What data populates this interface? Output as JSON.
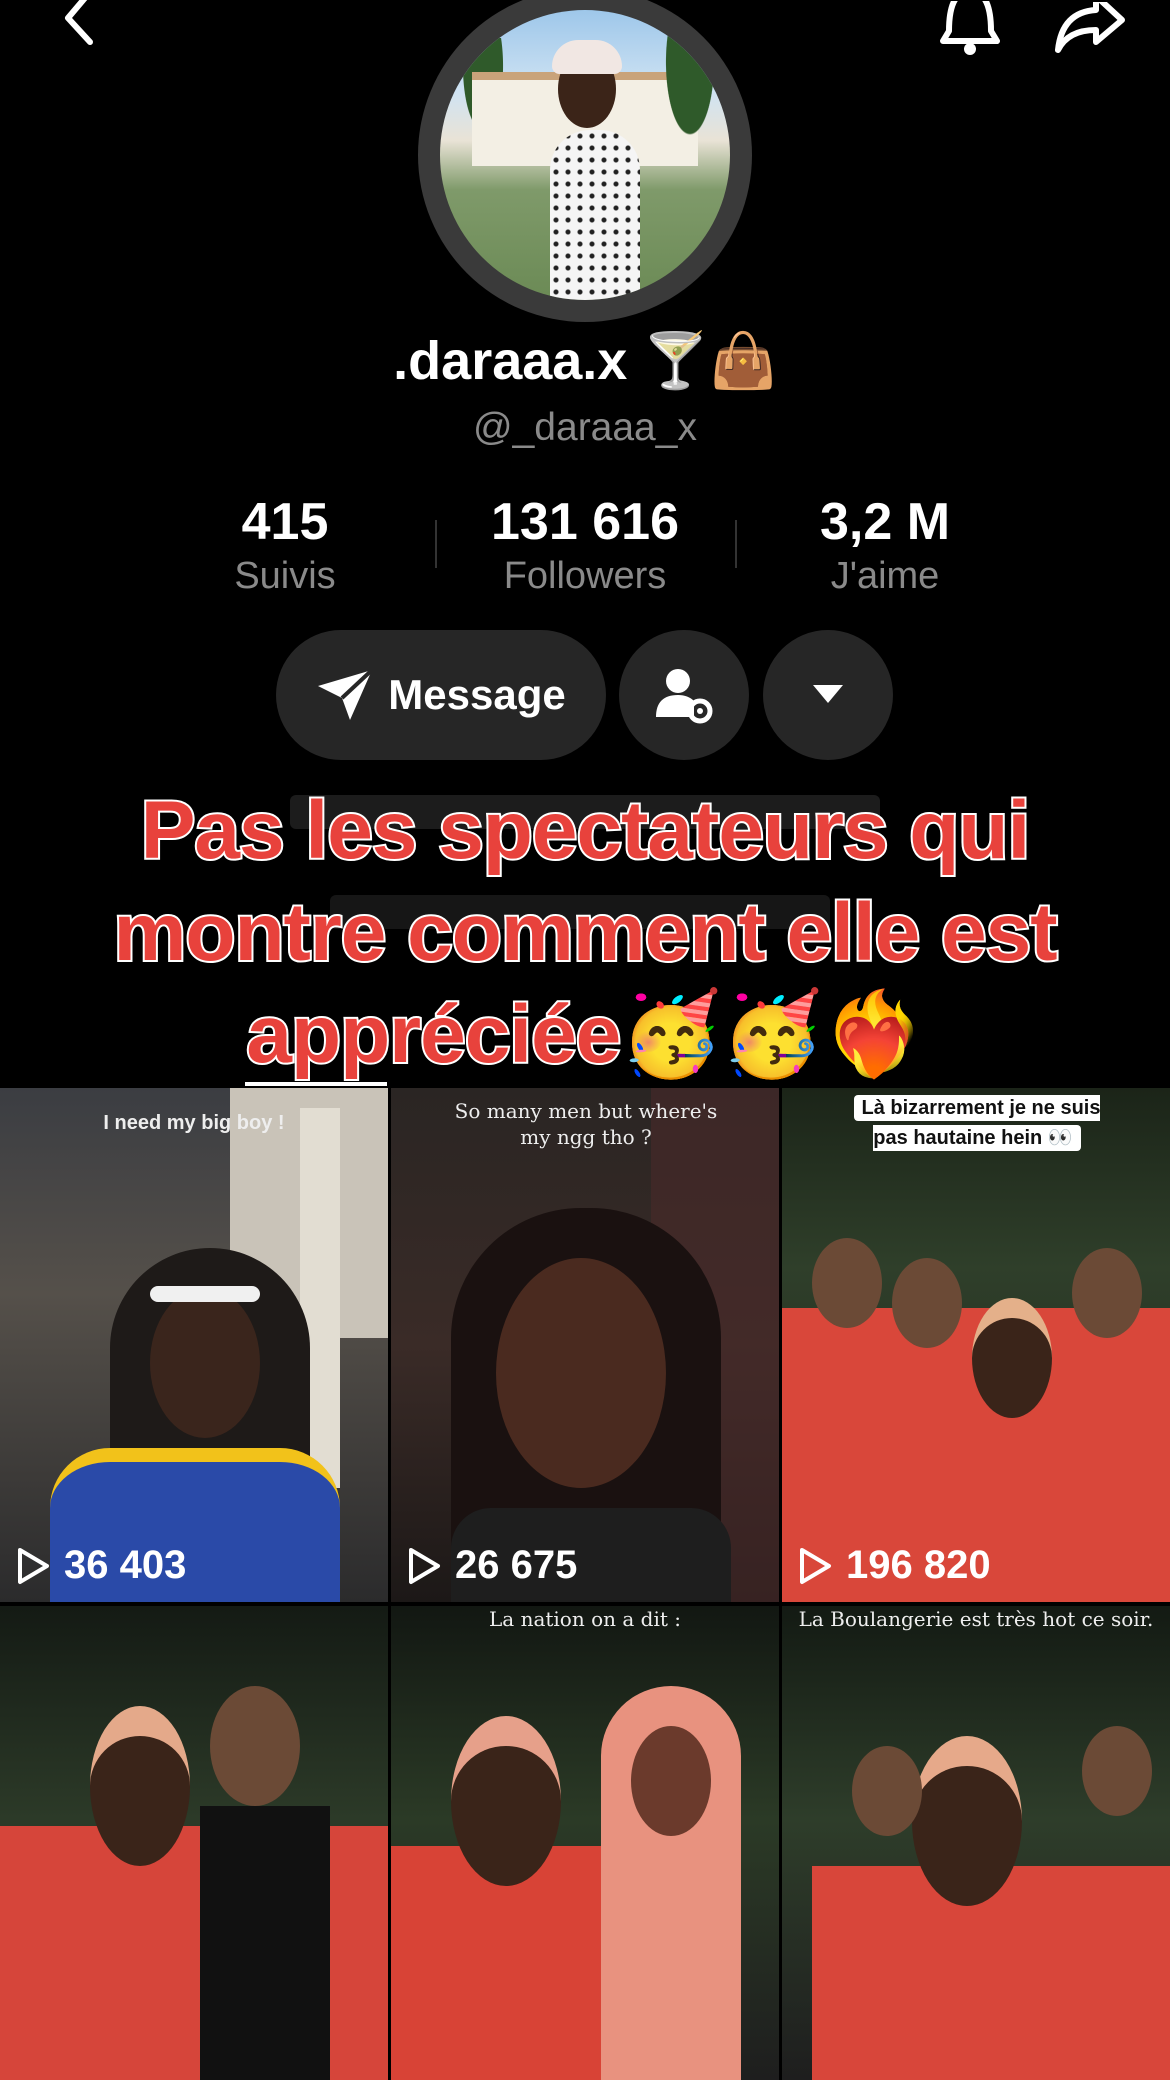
{
  "header": {
    "back_icon": "chevron-left-icon",
    "bell_icon": "bell-icon",
    "share_icon": "share-arrow-icon"
  },
  "profile": {
    "display_name": ".daraaa.x 🍸👜",
    "username": "@_daraaa_x"
  },
  "stats": [
    {
      "value": "415",
      "label": "Suivis"
    },
    {
      "value": "131 616",
      "label": "Followers"
    },
    {
      "value": "3,2 M",
      "label": "J'aime"
    }
  ],
  "actions": {
    "message_label": "Message"
  },
  "caption": {
    "line1": "Pas les spectateurs qui",
    "line2": "montre comment elle est",
    "line3": "appréciée🥳🥳❤️‍🔥"
  },
  "colors": {
    "background": "#000000",
    "button_bg": "#262626",
    "muted_text": "#8a8a8a",
    "caption_red": "#e8423c"
  },
  "videos": [
    {
      "caption": "I need my big boy !",
      "views": "36 403"
    },
    {
      "caption": "So many men but where's my ngg tho ?",
      "views": "26 675"
    },
    {
      "caption": "Là bizarrement je ne suis pas hautaine hein 👀",
      "views": "196 820"
    },
    {
      "caption": "",
      "views": ""
    },
    {
      "caption": "La nation on a dit :",
      "views": ""
    },
    {
      "caption": "La Boulangerie est très hot ce soir.",
      "views": ""
    }
  ]
}
